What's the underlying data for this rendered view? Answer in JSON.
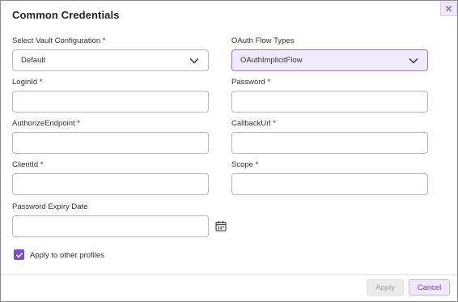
{
  "dialog": {
    "title": "Common Credentials",
    "close_glyph": "✕"
  },
  "fields": {
    "vault_config": {
      "label": "Select Vault Configuration *",
      "value": "Default"
    },
    "oauth_flow": {
      "label": "OAuth Flow Types",
      "value": "OAuthImplicitFlow"
    },
    "login_id": {
      "label": "LoginId *",
      "value": ""
    },
    "password": {
      "label": "Password *",
      "value": ""
    },
    "authorize_endpoint": {
      "label": "AuthorizeEndpoint *",
      "value": ""
    },
    "callback_url": {
      "label": "CallbackUrl *",
      "value": ""
    },
    "client_id": {
      "label": "ClientId *",
      "value": ""
    },
    "scope": {
      "label": "Scope *",
      "value": ""
    },
    "password_expiry": {
      "label": "Password Expiry Date",
      "value": ""
    }
  },
  "apply_profiles": {
    "label": "Apply to other profiles",
    "checked": true
  },
  "buttons": {
    "apply": "Apply",
    "cancel": "Cancel"
  },
  "icons": {
    "chevron": "chevron-down-icon",
    "calendar": "calendar-icon",
    "check": "check-icon",
    "close": "close-icon"
  },
  "colors": {
    "accent": "#7b4fc9",
    "accent_light": "#f1eafc"
  }
}
